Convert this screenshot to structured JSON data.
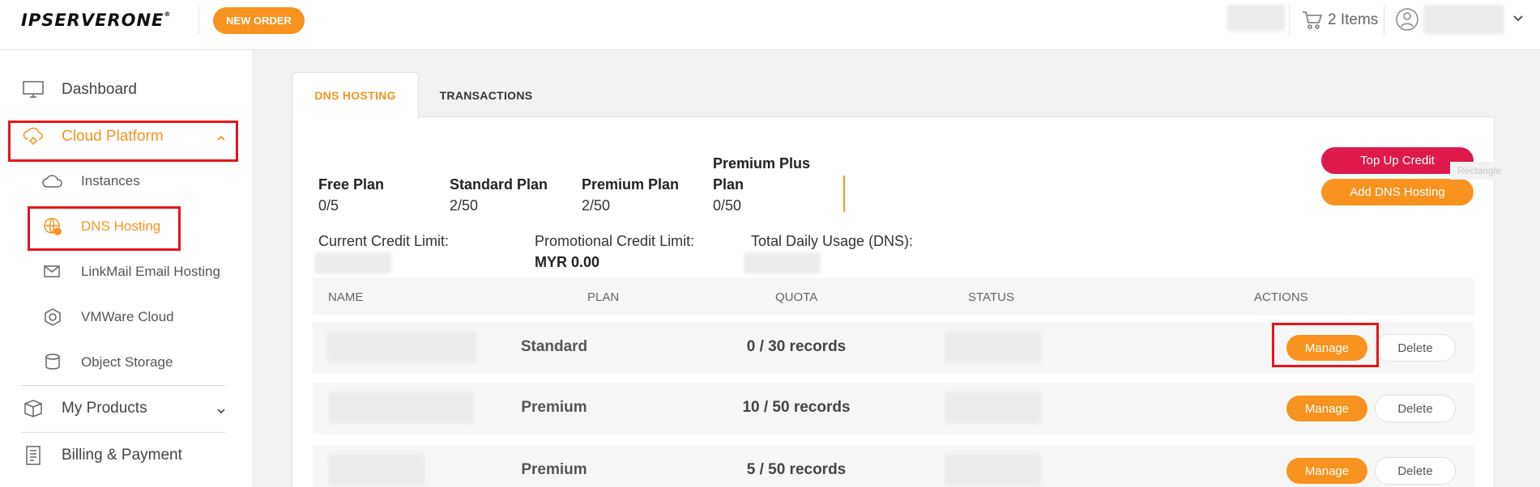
{
  "header": {
    "logo_text": "IPSERVERONE",
    "logo_mark": "®",
    "new_order_label": "NEW ORDER",
    "cart_label": "2 Items"
  },
  "sidebar": {
    "items": [
      {
        "label": "Dashboard",
        "icon": "monitor-icon"
      },
      {
        "label": "Cloud Platform",
        "icon": "cloud-gear-icon",
        "expanded": true
      },
      {
        "label": "Instances",
        "icon": "cloud-icon"
      },
      {
        "label": "DNS Hosting",
        "icon": "globe-icon",
        "active": true
      },
      {
        "label": "LinkMail Email Hosting",
        "icon": "mail-icon"
      },
      {
        "label": "VMWare Cloud",
        "icon": "cloud-hex-icon"
      },
      {
        "label": "Object Storage",
        "icon": "storage-icon"
      },
      {
        "label": "My Products",
        "icon": "box-icon"
      },
      {
        "label": "Billing & Payment",
        "icon": "receipt-icon"
      }
    ]
  },
  "tabs": [
    {
      "label": "DNS HOSTING",
      "active": true
    },
    {
      "label": "TRANSACTIONS",
      "active": false
    }
  ],
  "plans": [
    {
      "label": "Free Plan",
      "value": "0/5"
    },
    {
      "label": "Standard Plan",
      "value": "2/50"
    },
    {
      "label": "Premium Plan",
      "value": "2/50"
    },
    {
      "label_line1": "Premium Plus",
      "label_line2": "Plan",
      "value": "0/50"
    }
  ],
  "actions": {
    "topup_label": "Top Up Credit",
    "add_dns_label": "Add DNS Hosting",
    "ghost_label": "Rectangle"
  },
  "credit": {
    "current_label": "Current Credit Limit:",
    "promo_label": "Promotional Credit Limit:",
    "promo_value": "MYR 0.00",
    "usage_label": "Total Daily Usage (DNS):"
  },
  "table": {
    "headers": [
      "NAME",
      "PLAN",
      "QUOTA",
      "STATUS",
      "ACTIONS"
    ],
    "rows": [
      {
        "plan": "Standard",
        "quota": "0 / 30 records",
        "manage": "Manage",
        "delete": "Delete"
      },
      {
        "plan": "Premium",
        "quota": "10 / 50 records",
        "manage": "Manage",
        "delete": "Delete"
      },
      {
        "plan": "Premium",
        "quota": "5 / 50 records",
        "manage": "Manage",
        "delete": "Delete"
      }
    ]
  },
  "colors": {
    "accent": "#f7931e",
    "danger": "#de1a4d",
    "highlight_box": "#e8141b"
  }
}
